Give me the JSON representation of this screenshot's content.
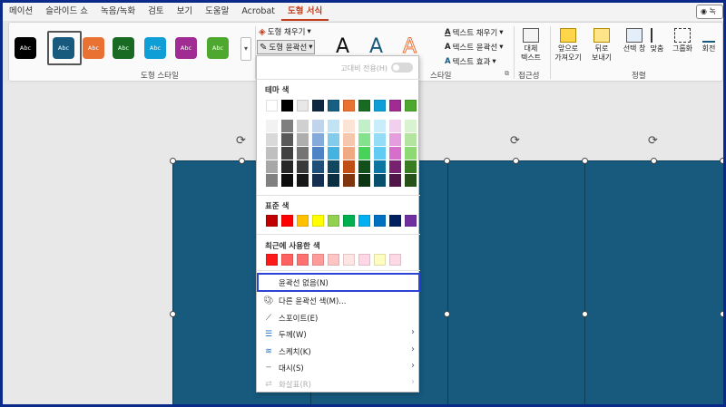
{
  "menu": {
    "tabs": [
      "메이션",
      "슬라이드 쇼",
      "녹음/녹화",
      "검토",
      "보기",
      "도움말",
      "Acrobat",
      "도형 서식"
    ],
    "active_tab": 7,
    "share_label": "녹"
  },
  "ribbon": {
    "shape_styles": {
      "items": [
        {
          "label": "Abc",
          "color": "#000000"
        },
        {
          "label": "Abc",
          "color": "#175a7e"
        },
        {
          "label": "Abc",
          "color": "#e97132"
        },
        {
          "label": "Abc",
          "color": "#196b24"
        },
        {
          "label": "Abc",
          "color": "#0f9ed5"
        },
        {
          "label": "Abc",
          "color": "#a02b93"
        },
        {
          "label": "Abc",
          "color": "#4ea72e"
        }
      ],
      "group_label": "도형 스타일"
    },
    "shape_fill_label": "도형 채우기",
    "shape_outline_label": "도형 윤곽선",
    "wordart": {
      "letters": [
        "A",
        "A",
        "A"
      ],
      "text_fill_label": "텍스트 채우기",
      "text_outline_label": "텍스트 윤곽선",
      "text_effects_label": "텍스트 효과",
      "group_label": "스타일"
    },
    "accessibility": {
      "alt_text_line1": "대체",
      "alt_text_line2": "텍스트",
      "group_label": "접근성"
    },
    "arrange": {
      "bring_forward": [
        "앞으로",
        "가져오기"
      ],
      "send_backward": [
        "뒤로",
        "보내기"
      ],
      "selection_pane": "선택 창",
      "align": "맞춤",
      "group": "그룹화",
      "rotate": "회전",
      "group_label": "정렬"
    }
  },
  "dropdown": {
    "high_contrast_label": "고대비 전용(H)",
    "theme_colors_label": "테마 색",
    "theme_top_row": [
      "#ffffff",
      "#000000",
      "#e8e8e8",
      "#0e2841",
      "#156082",
      "#e97132",
      "#196b24",
      "#0f9ed5",
      "#a02b93",
      "#4ea72e"
    ],
    "theme_tints": [
      [
        "#f2f2f2",
        "#7f7f7f",
        "#d0d0d0",
        "#c0d4eb",
        "#c1e4f5",
        "#fbe3d6",
        "#c1f0c8",
        "#caedfb",
        "#f2cfee",
        "#d9f2d0"
      ],
      [
        "#d9d9d9",
        "#595959",
        "#aeaeae",
        "#83aad9",
        "#83cbeb",
        "#f6c6ad",
        "#83e28e",
        "#95dcf7",
        "#e59edd",
        "#b3e5a1"
      ],
      [
        "#bfbfbf",
        "#404040",
        "#747474",
        "#4e83c5",
        "#44b3e1",
        "#f1a983",
        "#47d359",
        "#61cbf3",
        "#d86ecc",
        "#8ed973"
      ],
      [
        "#a6a6a6",
        "#262626",
        "#3a3a3a",
        "#1f4e79",
        "#104862",
        "#c04f15",
        "#124f1a",
        "#0b76a0",
        "#782170",
        "#3a7c22"
      ],
      [
        "#808080",
        "#0d0d0d",
        "#171717",
        "#142f4f",
        "#0a3041",
        "#7f350e",
        "#0c3511",
        "#074f6a",
        "#501549",
        "#265219"
      ]
    ],
    "standard_colors_label": "표준 색",
    "standard_colors": [
      "#c00000",
      "#ff0000",
      "#ffc000",
      "#ffff00",
      "#92d050",
      "#00b050",
      "#00b0f0",
      "#0070c0",
      "#002060",
      "#7030a0"
    ],
    "recent_colors_label": "최근에 사용한 색",
    "recent_colors": [
      "#ff1a1a",
      "#ff6060",
      "#ff7070",
      "#ff9a9a",
      "#ffc4c4",
      "#ffe4e4",
      "#ffd6e4",
      "#fffcc0",
      "#ffd8e6"
    ],
    "items": [
      {
        "label": "윤곽선 없음(N)",
        "icon": "",
        "highlighted": true,
        "submenu": false,
        "disabled": false
      },
      {
        "label": "다른 윤곽선 색(M)...",
        "icon": "palette-icon",
        "highlighted": false,
        "submenu": false,
        "disabled": false
      },
      {
        "label": "스포이트(E)",
        "icon": "eyedropper-icon",
        "highlighted": false,
        "submenu": false,
        "disabled": false
      },
      {
        "label": "두께(W)",
        "icon": "line-weight-icon",
        "highlighted": false,
        "submenu": true,
        "disabled": false
      },
      {
        "label": "스케치(K)",
        "icon": "sketch-line-icon",
        "highlighted": false,
        "submenu": true,
        "disabled": false
      },
      {
        "label": "대시(S)",
        "icon": "dash-line-icon",
        "highlighted": false,
        "submenu": true,
        "disabled": false
      },
      {
        "label": "화살표(R)",
        "icon": "arrow-line-icon",
        "highlighted": false,
        "submenu": true,
        "disabled": true
      }
    ]
  }
}
